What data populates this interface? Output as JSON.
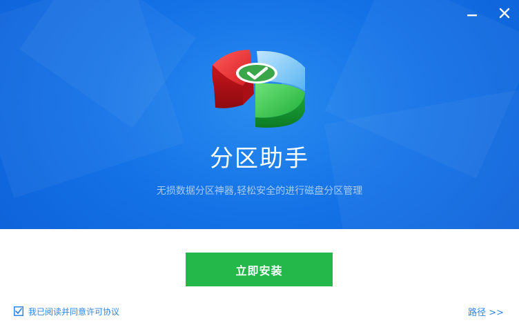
{
  "window": {
    "minimize_icon": "minimize-icon",
    "close_icon": "close-icon"
  },
  "app": {
    "title": "分区助手",
    "subtitle": "无损数据分区神器,轻松安全的进行磁盘分区管理",
    "logo_icon": "pie-chart-check-icon"
  },
  "actions": {
    "install_label": "立即安装",
    "agree_label": "我已阅读并同意许可协议",
    "agree_checked": true,
    "path_label": "路径 >>"
  },
  "colors": {
    "hero_blue": "#1472e6",
    "install_green": "#24b84a",
    "link_blue": "#2f86e8"
  }
}
